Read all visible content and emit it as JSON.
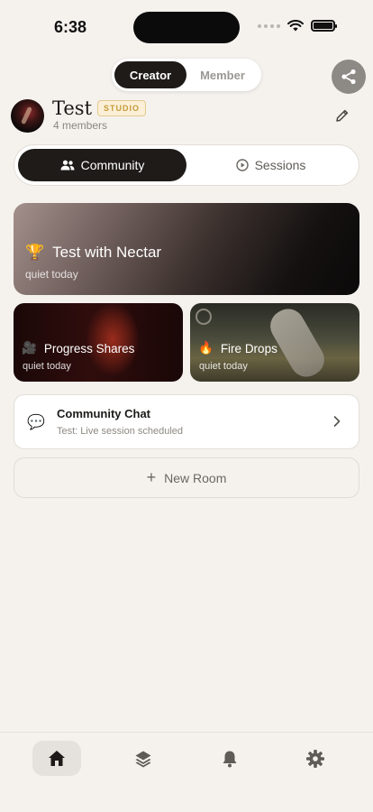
{
  "status": {
    "time": "6:38"
  },
  "mode_toggle": {
    "creator": "Creator",
    "member": "Member"
  },
  "header": {
    "title": "Test",
    "badge": "STUDIO",
    "members": "4 members"
  },
  "tabs": [
    {
      "label": "Community",
      "icon": "people-icon",
      "active": true
    },
    {
      "label": "Sessions",
      "icon": "play-circle-icon",
      "active": false
    }
  ],
  "featured_room": {
    "emoji": "🏆",
    "title": "Test with Nectar",
    "subtitle": "quiet today"
  },
  "rooms": [
    {
      "emoji": "🎥",
      "title": "Progress Shares",
      "subtitle": "quiet today"
    },
    {
      "emoji": "🔥",
      "title": "Fire Drops",
      "subtitle": "quiet today"
    }
  ],
  "chat": {
    "icon": "💬",
    "title": "Community Chat",
    "subtitle": "Test: Live session scheduled"
  },
  "new_room": {
    "label": "New Room",
    "icon": "+"
  },
  "nav": [
    {
      "name": "home-icon",
      "active": true
    },
    {
      "name": "layers-icon",
      "active": false
    },
    {
      "name": "bell-icon",
      "active": false
    },
    {
      "name": "gear-icon",
      "active": false
    }
  ],
  "colors": {
    "dark": "#1e1b18",
    "background": "#f5f2ee",
    "badge_gold": "#c49a3a"
  }
}
